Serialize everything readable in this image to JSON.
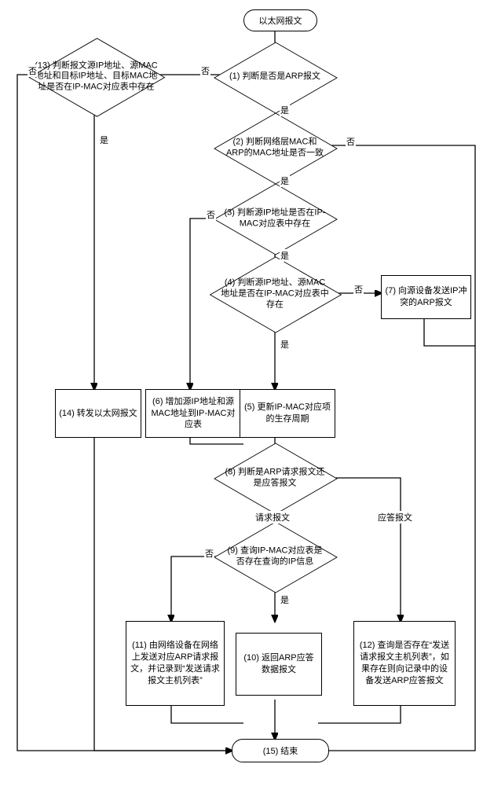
{
  "start": "以太网报文",
  "d1": "(1) 判断是否是ARP报文",
  "d2": "(2) 判断网络层MAC和ARP的MAC地址是否一致",
  "d3": "(3) 判断源IP地址是否在IP-MAC对应表中存在",
  "d4": "(4) 判断源IP地址、源MAC地址是否在IP-MAC对应表中存在",
  "p5": "(5) 更新IP-MAC对应项的生存周期",
  "p6": "(6) 增加源IP地址和源MAC地址到IP-MAC对应表",
  "p7": "(7) 向源设备发送IP冲突的ARP报文",
  "d8": "(8) 判断是ARP请求报文还是应答报文",
  "d9": "(9) 查询IP-MAC对应表是否存在查询的IP信息",
  "p10": "(10) 返回ARP应答数据报文",
  "p11": "(11) 由网络设备在网络上发送对应ARP请求报文，并记录到“发送请求报文主机列表”",
  "p12": "(12) 查询是否存在“发送请求报文主机列表”，如果存在则向记录中的设备发送ARP应答报文",
  "d13": "(13) 判断报文源IP地址、源MAC地址和目标IP地址、目标MAC地址是否在IP-MAC对应表中存在",
  "p14": "(14) 转发以太网报文",
  "end": "(15) 结束",
  "labels": {
    "yes": "是",
    "no": "否",
    "req": "请求报文",
    "resp": "应答报文"
  }
}
